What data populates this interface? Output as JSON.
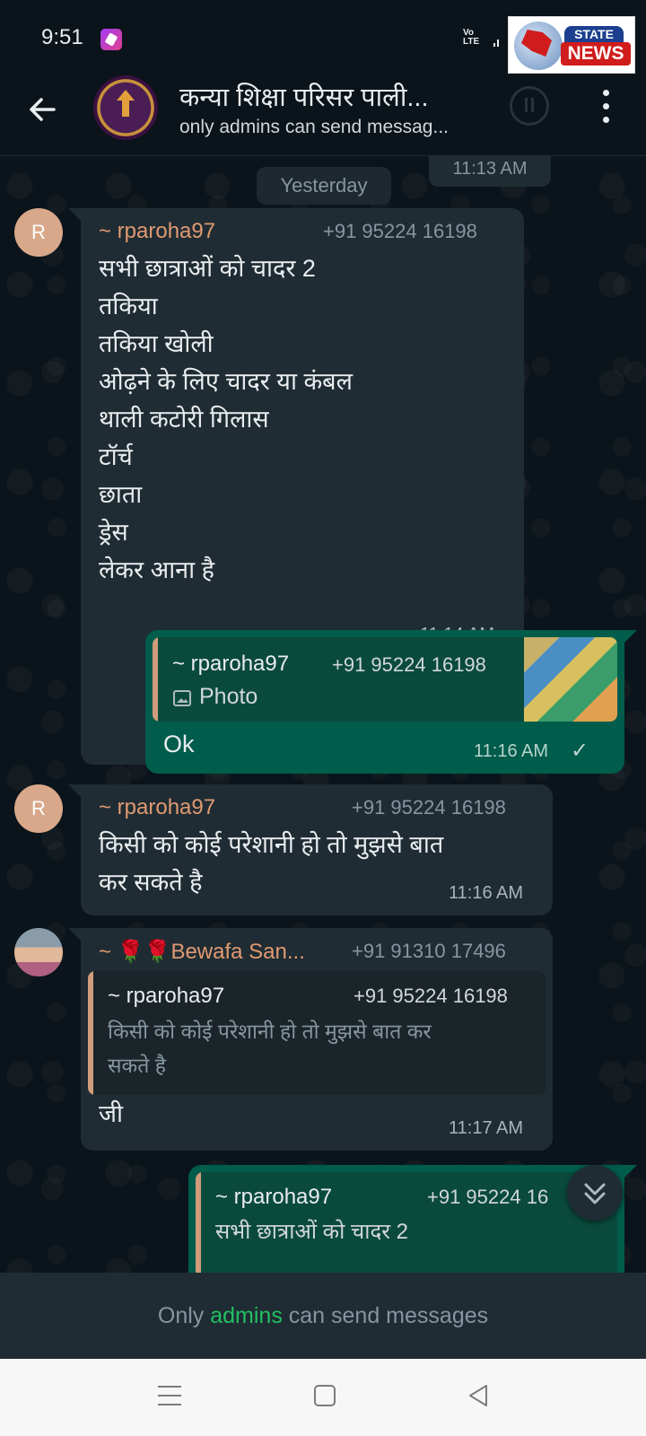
{
  "status_bar": {
    "time": "9:51",
    "network_label": "VoD LTE"
  },
  "watermark": {
    "top_text": "STATE",
    "bottom_text": "NEWS"
  },
  "header": {
    "title": "कन्या शिक्षा परिसर पाली...",
    "subtitle": "only admins can send messag..."
  },
  "chat": {
    "previous_time": "11:13 AM",
    "date_separator": "Yesterday",
    "messages": [
      {
        "direction": "in",
        "avatar_letter": "R",
        "sender": "~ rparoha97",
        "phone": "+91 95224 16198",
        "text": "सभी छात्राओं को चादर 2\nतकिया\nतकिया खोली\nओढ़ने के लिए चादर या कंबल\nथाली कटोरी गिलास\nटॉर्च\nछाता\nड्रेस\nलेकर आना है",
        "time": "11:14 AM"
      },
      {
        "direction": "out",
        "quote_sender": "~ rparoha97",
        "quote_phone": "+91 95224 16198",
        "quote_text": "Photo",
        "text": "Ok",
        "time": "11:16 AM",
        "status": "✓"
      },
      {
        "direction": "in",
        "avatar_letter": "R",
        "sender": "~ rparoha97",
        "phone": "+91 95224 16198",
        "text": "किसी को कोई परेशानी हो तो मुझसे बात\nकर सकते है",
        "time": "11:16 AM"
      },
      {
        "direction": "in",
        "sender": "~ 🌹🌹Bewafa San...",
        "phone": "+91 91310 17496",
        "quote_sender": "~ rparoha97",
        "quote_phone": "+91 95224 16198",
        "quote_text": "किसी को कोई परेशानी हो तो मुझसे बात कर\nसकते है",
        "text": "जी",
        "time": "11:17 AM"
      },
      {
        "direction": "out",
        "quote_sender": "~ rparoha97",
        "quote_phone": "+91 95224 16",
        "quote_text": "सभी छात्राओं को चादर 2"
      }
    ]
  },
  "footer": {
    "prefix": "Only ",
    "link": "admins",
    "suffix": " can send messages"
  },
  "colors": {
    "background": "#0b141a",
    "incoming_bubble": "#202c33",
    "outgoing_bubble": "#005c4b",
    "sender_name": "#e09a72",
    "admins_link": "#21c063"
  }
}
